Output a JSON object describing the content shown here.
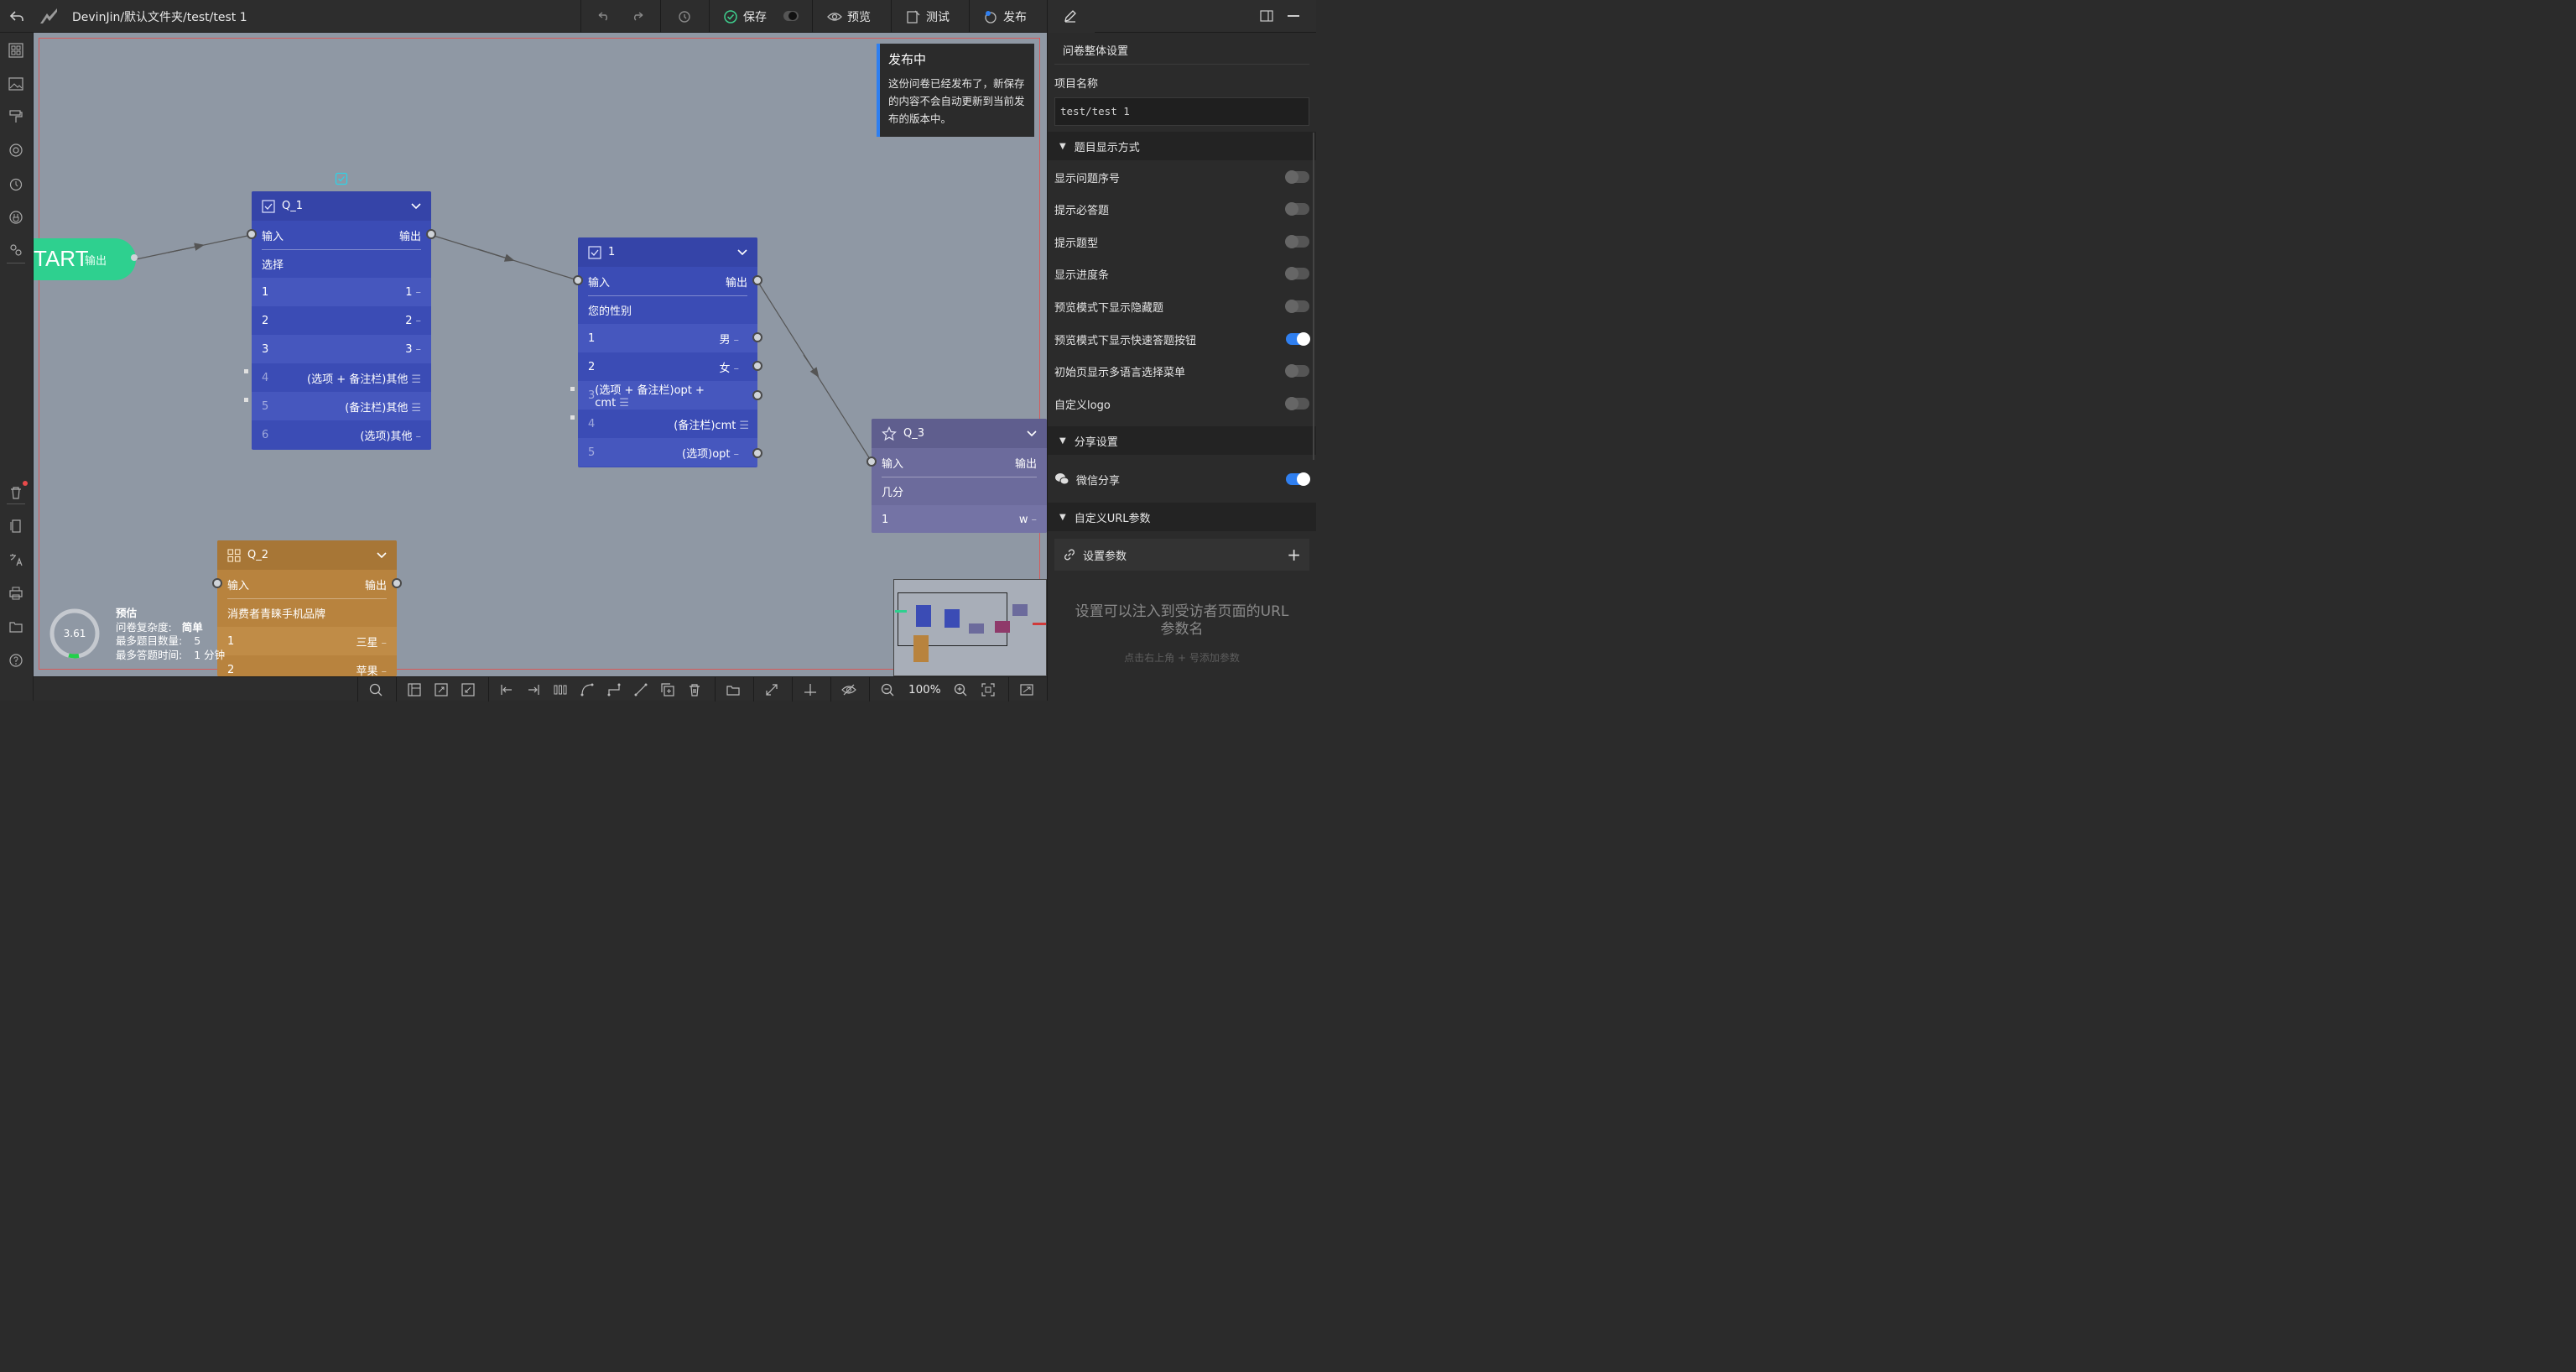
{
  "topbar": {
    "path": "DevinJin/默认文件夹/test/test 1",
    "save": "保存",
    "preview": "预览",
    "test": "测试",
    "publish": "发布"
  },
  "notice": {
    "title": "发布中",
    "body": "这份问卷已经发布了，新保存的内容不会自动更新到当前发布的版本中。"
  },
  "start": {
    "label": "TART",
    "out": "输出"
  },
  "q1": {
    "title": "Q_1",
    "in": "输入",
    "out": "输出",
    "question": "选择",
    "options": [
      {
        "n": "1",
        "v": "1"
      },
      {
        "n": "2",
        "v": "2"
      },
      {
        "n": "3",
        "v": "3"
      },
      {
        "n": "4",
        "v": "(选项 + 备注栏)其他"
      },
      {
        "n": "5",
        "v": "(备注栏)其他"
      },
      {
        "n": "6",
        "v": "(选项)其他"
      }
    ]
  },
  "n1": {
    "title": "1",
    "in": "输入",
    "out": "输出",
    "question": "您的性别",
    "options": [
      {
        "n": "1",
        "v": "男"
      },
      {
        "n": "2",
        "v": "女"
      },
      {
        "n": "3",
        "v": "(选项 + 备注栏)opt + cmt"
      },
      {
        "n": "4",
        "v": "(备注栏)cmt"
      },
      {
        "n": "5",
        "v": "(选项)opt"
      }
    ]
  },
  "q3": {
    "title": "Q_3",
    "in": "输入",
    "out": "输出",
    "question": "几分",
    "options": [
      {
        "n": "1",
        "v": "w"
      }
    ]
  },
  "q2": {
    "title": "Q_2",
    "in": "输入",
    "out": "输出",
    "question": "消费者青睐手机品牌",
    "options": [
      {
        "n": "1",
        "v": "三星"
      },
      {
        "n": "2",
        "v": "苹果"
      }
    ]
  },
  "estimate": {
    "score": "3.61",
    "title": "预估",
    "complexity_label": "问卷复杂度:",
    "complexity_value": "简单",
    "max_questions_label": "最多题目数量:",
    "max_questions_value": "5",
    "max_time_label": "最多答题时间:",
    "max_time_value": "1 分钟"
  },
  "zoom": "100%",
  "panel": {
    "title": "问卷整体设置",
    "project_label": "项目名称",
    "project_value": "test/test 1",
    "section_display": "题目显示方式",
    "settings": [
      {
        "label": "显示问题序号",
        "on": false
      },
      {
        "label": "提示必答题",
        "on": false
      },
      {
        "label": "提示题型",
        "on": false
      },
      {
        "label": "显示进度条",
        "on": false
      },
      {
        "label": "预览模式下显示隐藏题",
        "on": false
      },
      {
        "label": "预览模式下显示快速答题按钮",
        "on": true
      },
      {
        "label": "初始页显示多语言选择菜单",
        "on": false
      },
      {
        "label": "自定义logo",
        "on": false
      }
    ],
    "section_share": "分享设置",
    "wechat_share": "微信分享",
    "wechat_on": true,
    "section_url": "自定义URL参数",
    "set_params": "设置参数",
    "url_hint_title": "设置可以注入到受访者页面的URL参数名",
    "url_hint_sub": "点击右上角 + 号添加参数"
  },
  "colors": {
    "q1": "#3b4cb5",
    "n1": "#3b4cb5",
    "q3": "#6c6b9c",
    "q2": "#b8833e",
    "start": "#2ed08f",
    "toggle_on": "#2f7ff0"
  }
}
